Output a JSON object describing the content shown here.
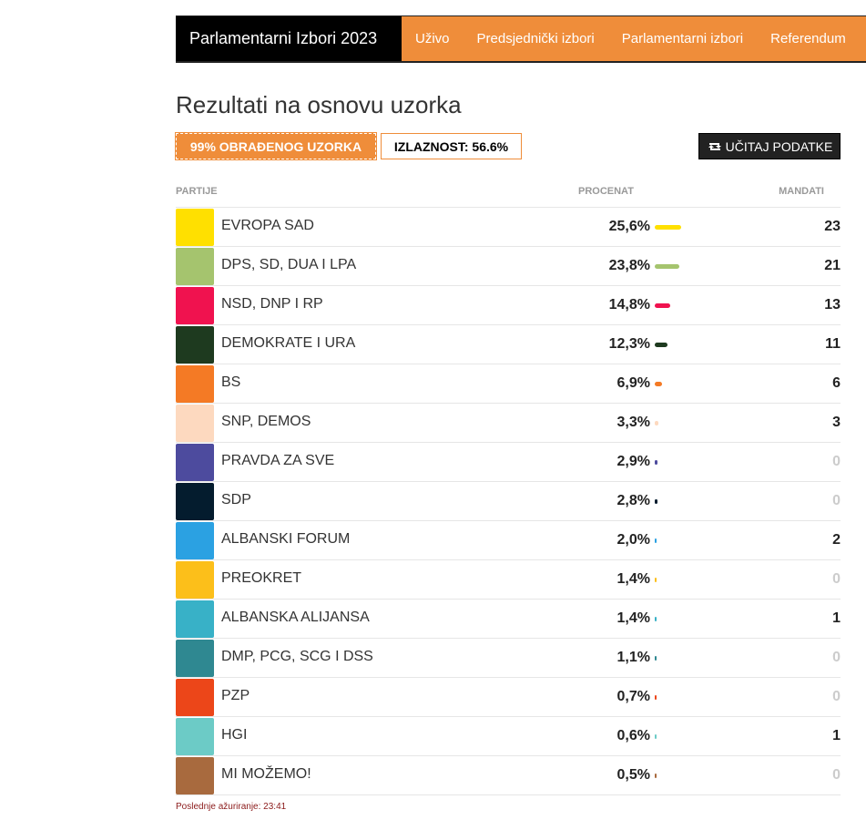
{
  "nav": {
    "brand": "Parlamentarni Izbori 2023",
    "items": [
      "Uživo",
      "Predsjednički izbori",
      "Parlamentarni izbori",
      "Referendum"
    ]
  },
  "page_title": "Rezultati na osnovu uzorka",
  "badges": {
    "processed": "99% OBRAĐENOG UZORKA",
    "turnout": "IZLAZNOST: 56.6%"
  },
  "load_button": {
    "label": "UČITAJ PODATKE",
    "icon": "refresh-icon"
  },
  "table": {
    "headers": {
      "party": "PARTIJE",
      "percent": "PROCENAT",
      "seats": "MANDATI"
    },
    "rows": [
      {
        "name": "EVROPA SAD",
        "percent": "25,6%",
        "value": 25.6,
        "seats": "23",
        "color": "#ffe000"
      },
      {
        "name": "DPS, SD, DUA I LPA",
        "percent": "23,8%",
        "value": 23.8,
        "seats": "21",
        "color": "#a5c46e"
      },
      {
        "name": "NSD, DNP I RP",
        "percent": "14,8%",
        "value": 14.8,
        "seats": "13",
        "color": "#f0124f"
      },
      {
        "name": "DEMOKRATE I URA",
        "percent": "12,3%",
        "value": 12.3,
        "seats": "11",
        "color": "#1e3a1f"
      },
      {
        "name": "BS",
        "percent": "6,9%",
        "value": 6.9,
        "seats": "6",
        "color": "#f47a25"
      },
      {
        "name": "SNP, DEMOS",
        "percent": "3,3%",
        "value": 3.3,
        "seats": "3",
        "color": "#fdd9bf"
      },
      {
        "name": "PRAVDA ZA SVE",
        "percent": "2,9%",
        "value": 2.9,
        "seats": "0",
        "color": "#4d4b9e"
      },
      {
        "name": "SDP",
        "percent": "2,8%",
        "value": 2.8,
        "seats": "0",
        "color": "#041c2e"
      },
      {
        "name": "ALBANSKI FORUM",
        "percent": "2,0%",
        "value": 2.0,
        "seats": "2",
        "color": "#2ba1e2"
      },
      {
        "name": "PREOKRET",
        "percent": "1,4%",
        "value": 1.4,
        "seats": "0",
        "color": "#fcbf1a"
      },
      {
        "name": "ALBANSKA ALIJANSA",
        "percent": "1,4%",
        "value": 1.4,
        "seats": "1",
        "color": "#38b1c7"
      },
      {
        "name": "DMP, PCG, SCG I DSS",
        "percent": "1,1%",
        "value": 1.1,
        "seats": "0",
        "color": "#2f8891"
      },
      {
        "name": "PZP",
        "percent": "0,7%",
        "value": 0.7,
        "seats": "0",
        "color": "#ec4619"
      },
      {
        "name": "HGI",
        "percent": "0,6%",
        "value": 0.6,
        "seats": "1",
        "color": "#6ccbc6"
      },
      {
        "name": "MI MOŽEMO!",
        "percent": "0,5%",
        "value": 0.5,
        "seats": "0",
        "color": "#a86a3e"
      }
    ]
  },
  "footnote": "Poslednje ažuriranje: 23:41"
}
